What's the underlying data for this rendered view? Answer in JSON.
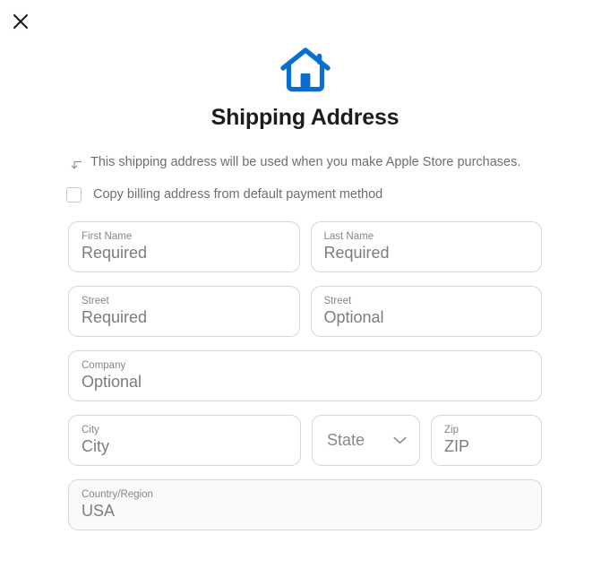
{
  "window": {
    "close_label": "Close",
    "close_icon": "close-icon"
  },
  "header": {
    "hero_icon": "house-icon",
    "hero_icon_color": "#0A6ED1",
    "title": "Shipping Address"
  },
  "note": {
    "icon": "arrow-turn-down-left-icon",
    "text": "This shipping address will be used when you make Apple Store purchases."
  },
  "copy_billing": {
    "label": "Copy billing address from default payment method",
    "checked": false
  },
  "form": {
    "rows": [
      {
        "fields": [
          {
            "name": "first-name",
            "label": "First Name",
            "value": "Required",
            "type": "text",
            "readonly": false
          },
          {
            "name": "last-name",
            "label": "Last Name",
            "value": "Required",
            "type": "text",
            "readonly": false
          }
        ]
      },
      {
        "fields": [
          {
            "name": "street-line-1",
            "label": "Street",
            "value": "Required",
            "type": "text",
            "readonly": false
          },
          {
            "name": "street-line-2",
            "label": "Street",
            "value": "Optional",
            "type": "text",
            "readonly": false
          }
        ]
      },
      {
        "fields": [
          {
            "name": "company",
            "label": "Company",
            "value": "Optional",
            "type": "text",
            "readonly": false
          }
        ]
      },
      {
        "fields": [
          {
            "name": "city",
            "label": "City",
            "value": "City",
            "type": "text",
            "readonly": false
          },
          {
            "name": "state",
            "label": "State",
            "value": "State",
            "type": "select",
            "readonly": false
          },
          {
            "name": "zip",
            "label": "Zip",
            "value": "ZIP",
            "type": "text",
            "readonly": false
          }
        ]
      },
      {
        "fields": [
          {
            "name": "country-region",
            "label": "Country/Region",
            "value": "USA",
            "type": "text",
            "readonly": true
          }
        ]
      }
    ],
    "first_name": {
      "label": "First Name",
      "value": "Required"
    },
    "last_name": {
      "label": "Last Name",
      "value": "Required"
    },
    "street_1": {
      "label": "Street",
      "value": "Required"
    },
    "street_2": {
      "label": "Street",
      "value": "Optional"
    },
    "company": {
      "label": "Company",
      "value": "Optional"
    },
    "city": {
      "label": "City",
      "value": "City"
    },
    "state": {
      "label": "State",
      "value": "State"
    },
    "zip": {
      "label": "Zip",
      "value": "ZIP"
    },
    "country": {
      "label": "Country/Region",
      "value": "USA"
    }
  },
  "colors": {
    "accent": "#0A6ED1",
    "text_primary": "#1d1d1f",
    "text_secondary": "#6e6e73",
    "text_placeholder": "#7c7c81",
    "label": "#86868b",
    "border": "#d6d6da",
    "readonly_bg": "#fafafa",
    "background": "#ffffff"
  }
}
